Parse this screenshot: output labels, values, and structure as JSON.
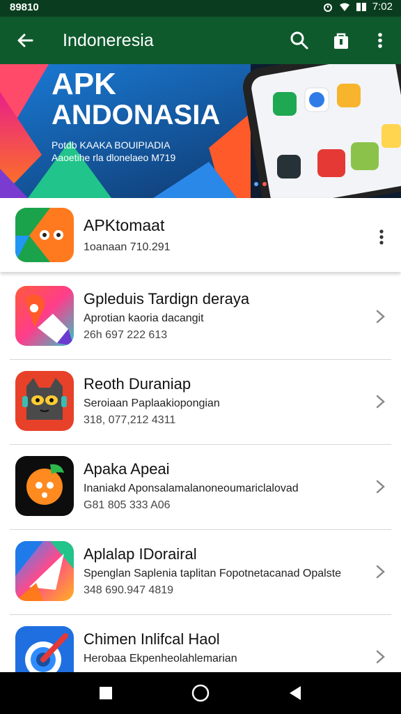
{
  "status_bar": {
    "time_left": "89810",
    "time_right": "7:02"
  },
  "app_bar": {
    "title": "Indoneresia"
  },
  "banner": {
    "title_line1": "APK",
    "title_line2": "ANDONASIA",
    "subtitle_line1": "Potdb KAAKA BOUIPIADIA",
    "subtitle_line2": "Aaoetihe rla dlonelaeo M719"
  },
  "featured": {
    "name": "APKtomaat",
    "subtitle": "1oanaan 710.291"
  },
  "apps": [
    {
      "name": "Gpleduis Tardign deraya",
      "desc": "Aprotian kaoria dacangit",
      "meta": "26h 697 222 613"
    },
    {
      "name": "Reoth Duraniap",
      "desc": "Seroiaan Paplaakiopongian",
      "meta": "318, 077,212 4311"
    },
    {
      "name": "Apaka Apeai",
      "desc": "Inaniakd Aponsalamalanoneoumariclalovad",
      "meta": "G81 805 333 A06"
    },
    {
      "name": "Aplalap IDorairal",
      "desc": "Spenglan Saplenia taplitan Fopotnetacanad Opalste",
      "meta": "348 690.947 4819"
    },
    {
      "name": "Chimen Inlifcal Haol",
      "desc": "Herobaa Ekpenheolahlemarian",
      "meta": ""
    }
  ],
  "icons": {
    "back": "arrow-back-icon",
    "search": "search-icon",
    "store": "store-icon",
    "more": "more-vert-icon",
    "chevron": "chevron-right-icon",
    "nav_recent": "square-icon",
    "nav_home": "circle-icon",
    "nav_back": "triangle-back-icon"
  },
  "colors": {
    "status_bar": "#0a3d1f",
    "app_bar": "#0f5a2d",
    "nav_bar": "#000000"
  }
}
